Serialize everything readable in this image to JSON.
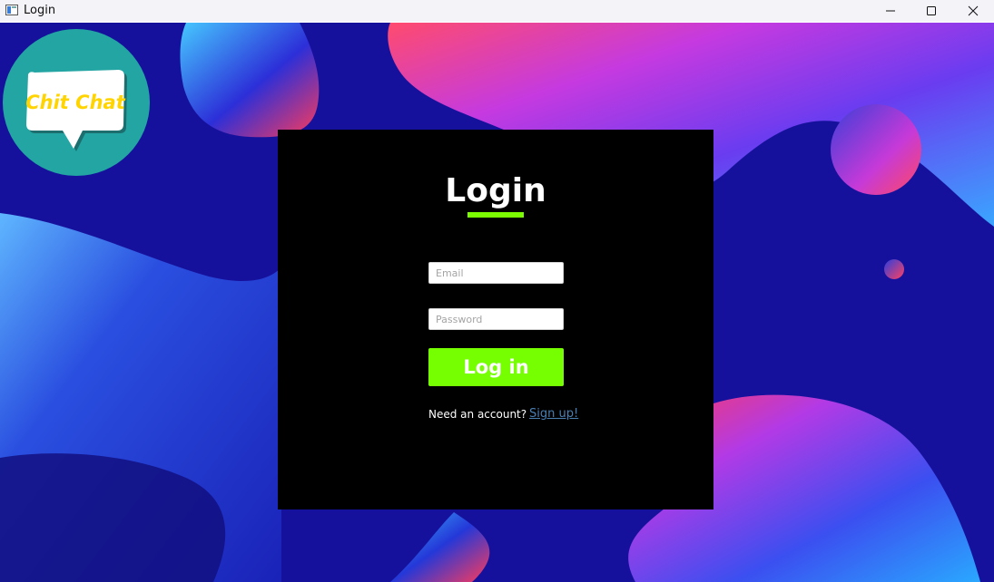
{
  "window": {
    "title": "Login",
    "controls": {
      "minimize_icon": "minimize-icon",
      "maximize_icon": "maximize-icon",
      "close_icon": "close-icon"
    }
  },
  "logo": {
    "text": "Chit Chat",
    "colors": {
      "circle": "#22a5a3",
      "bubble": "#ffffff",
      "text": "#ffd400"
    }
  },
  "login": {
    "heading": "Login",
    "email_placeholder": "Email",
    "email_value": "",
    "password_placeholder": "Password",
    "password_value": "",
    "login_button": "Log in",
    "need_account": "Need an account?",
    "signup_link": "Sign up!"
  },
  "colors": {
    "accent": "#75ff00",
    "panel": "#000000",
    "background": "#15129a",
    "link": "#4a7fb3"
  }
}
